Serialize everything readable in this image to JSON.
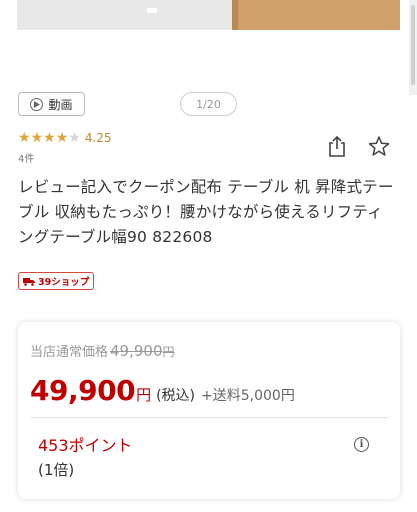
{
  "gallery": {
    "video_label": "動画",
    "pager": "1/20"
  },
  "rating": {
    "stars_filled": 4,
    "stars_total": 5,
    "value": "4.25",
    "count": "4件"
  },
  "product": {
    "title": "レビュー記入でクーポン配布 テーブル 机 昇降式テーブル 収納もたっぷり！腰かけながら使えるリフティングテーブル幅90 822608"
  },
  "shop_badge": {
    "label": "39ショップ",
    "color": "#bf0000"
  },
  "price": {
    "regular_label": "当店通常価格",
    "regular_value": "49,900",
    "regular_unit": "円",
    "sale_value": "49,900",
    "sale_unit": "円",
    "tax_label": "(税込)",
    "shipping": "+送料5,000円",
    "points": "453ポイント",
    "points_rate": "(1倍)"
  },
  "icons": {
    "share": "share-icon",
    "favorite": "star-outline-icon",
    "info": "info-icon",
    "play": "play-icon",
    "truck": "truck-icon"
  },
  "colors": {
    "accent": "#bf0000",
    "star": "#e0a43a"
  }
}
